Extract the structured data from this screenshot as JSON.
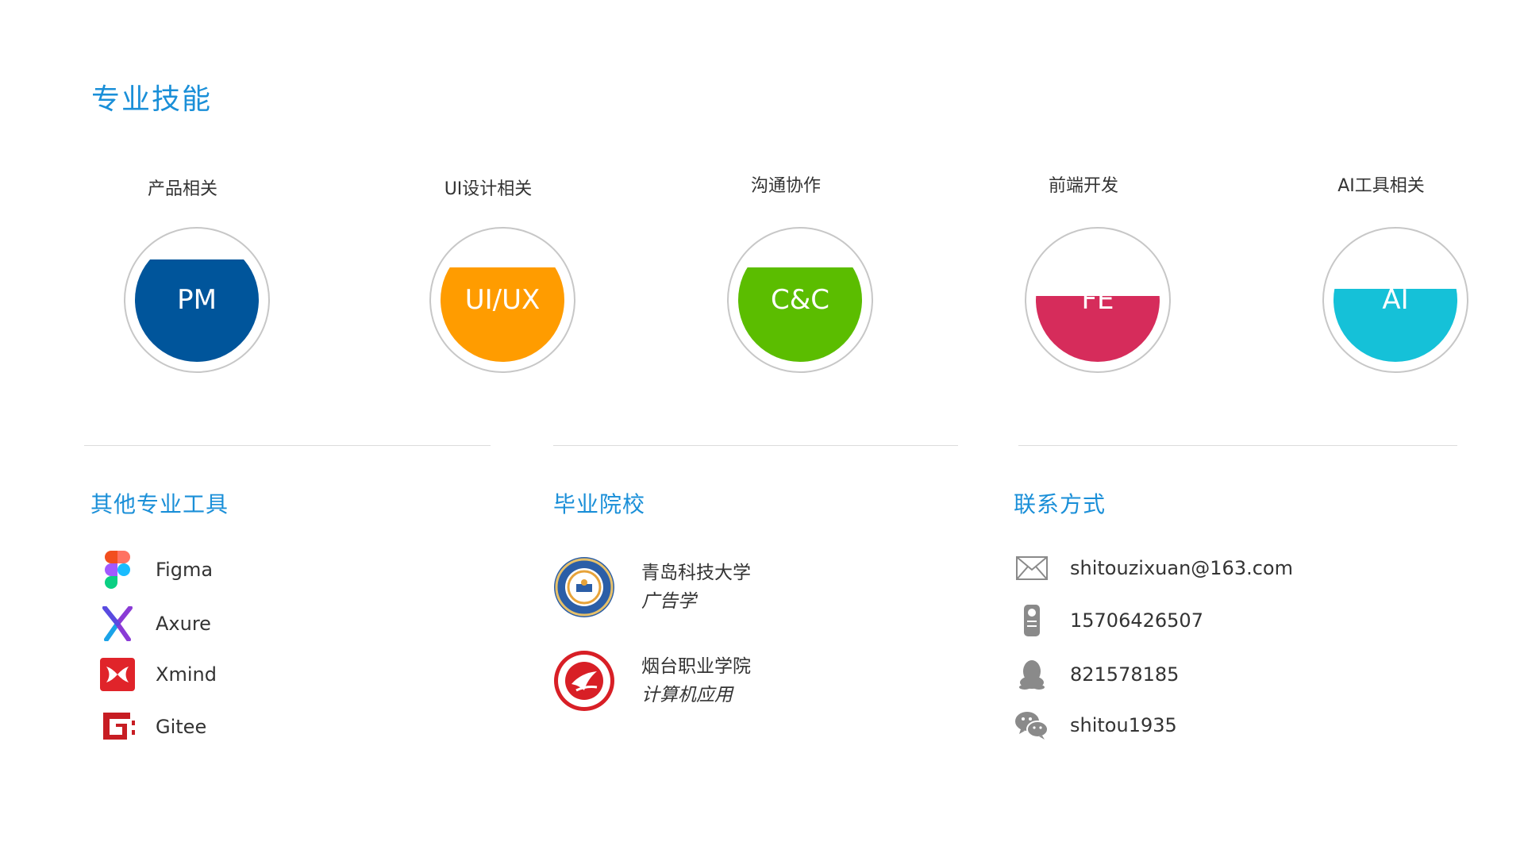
{
  "page": {
    "title": "专业技能"
  },
  "skills": [
    {
      "label": "产品相关",
      "code": "PM",
      "color": "#00559b",
      "level": 0.83
    },
    {
      "label": "UI设计相关",
      "code": "UI/UX",
      "color": "#ff9c00",
      "level": 0.76
    },
    {
      "label": "沟通协作",
      "code": "C&C",
      "color": "#5bbd00",
      "level": 0.76
    },
    {
      "label": "前端开发",
      "code": "FE",
      "color": "#d62c5b",
      "level": 0.53
    },
    {
      "label": "AI工具相关",
      "code": "AI",
      "color": "#15c1d8",
      "level": 0.59
    }
  ],
  "tools": {
    "title": "其他专业工具",
    "items": [
      {
        "name": "Figma",
        "icon": "figma-icon"
      },
      {
        "name": "Axure",
        "icon": "axure-icon"
      },
      {
        "name": "Xmind",
        "icon": "xmind-icon"
      },
      {
        "name": "Gitee",
        "icon": "gitee-icon"
      }
    ]
  },
  "education": {
    "title": "毕业院校",
    "schools": [
      {
        "name": "青岛科技大学",
        "major": "广告学",
        "logo": "qust-logo"
      },
      {
        "name": "烟台职业学院",
        "major": "计算机应用",
        "logo": "ytvc-logo"
      }
    ]
  },
  "contact": {
    "title": "联系方式",
    "email": "shitouzixuan@163.com",
    "phone": "15706426507",
    "qq": "821578185",
    "wechat": "shitou1935"
  },
  "colors": {
    "accent": "#1a8fd8",
    "ring": "#c7c7c7",
    "divider": "#dcdcdc",
    "contact_icon": "#8a8a8a"
  }
}
